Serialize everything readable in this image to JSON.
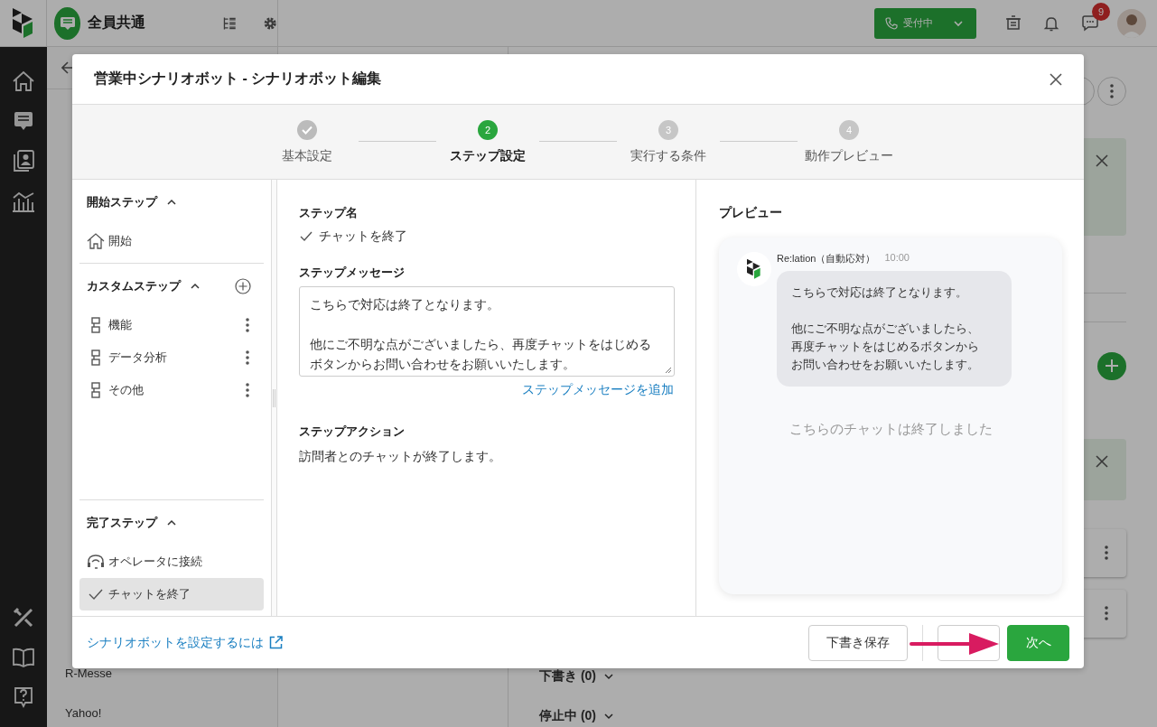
{
  "topbar": {
    "workspace": "全員共通",
    "status_button": "受付中",
    "notification_count": "9"
  },
  "background_list": {
    "items": [
      "R-Messe",
      "Yahoo!"
    ]
  },
  "main": {
    "sections": [
      {
        "label": "下書き (0)",
        "expanded": false
      },
      {
        "label": "停止中 (0)",
        "expanded": false
      }
    ]
  },
  "dialog": {
    "title": "営業中シナリオボット - シナリオボット編集",
    "steps": [
      {
        "label": "基本設定",
        "done": true,
        "selected": false
      },
      {
        "label": "ステップ設定",
        "number": "2",
        "done": false,
        "selected": true
      },
      {
        "label": "実行する条件",
        "number": "3",
        "done": false,
        "selected": false
      },
      {
        "label": "動作プレビュー",
        "number": "4",
        "done": false,
        "selected": false
      }
    ],
    "sidebar": {
      "sections": [
        {
          "title": "開始ステップ",
          "expanded": true,
          "items": [
            {
              "label": "開始",
              "kind": "start",
              "selected": false
            }
          ]
        },
        {
          "title": "カスタムステップ",
          "expanded": true,
          "items": [
            {
              "label": "機能",
              "kind": "custom",
              "selected": false
            },
            {
              "label": "データ分析",
              "kind": "custom",
              "selected": false
            },
            {
              "label": "その他",
              "kind": "custom",
              "selected": false
            }
          ]
        },
        {
          "title": "完了ステップ",
          "expanded": true,
          "items": [
            {
              "label": "オペレータに接続",
              "kind": "operator",
              "selected": false
            },
            {
              "label": "チャットを終了",
              "kind": "end",
              "selected": true
            }
          ]
        }
      ]
    },
    "form": {
      "name_label": "ステップ名",
      "name_value": "チャットを終了",
      "message_label": "ステップメッセージ",
      "message_paragraphs": [
        "こちらで対応は終了となります。",
        "他にご不明な点がございましたら、再度チャットをはじめるボタンからお問い合わせをお願いいたします。"
      ],
      "add_message_link": "ステップメッセージを追加",
      "action_label": "ステップアクション",
      "action_text": "訪問者とのチャットが終了します。"
    },
    "preview": {
      "title": "プレビュー",
      "sender": "Re:lation（自動応対）",
      "time": "10:00",
      "message_paragraphs": [
        "こちらで対応は終了となります。",
        "他にご不明な点がございましたら、再度チャットをはじめるボタンからお問い合わせをお願いいたします。"
      ],
      "ended_notice": "こちらのチャットは終了しました"
    },
    "help_link": "シナリオボットを設定するには",
    "buttons": [
      {
        "label": "下書き保存",
        "kind": "secondary"
      },
      {
        "kind": "secondary"
      },
      {
        "label": "次へ",
        "kind": "primary"
      }
    ]
  }
}
